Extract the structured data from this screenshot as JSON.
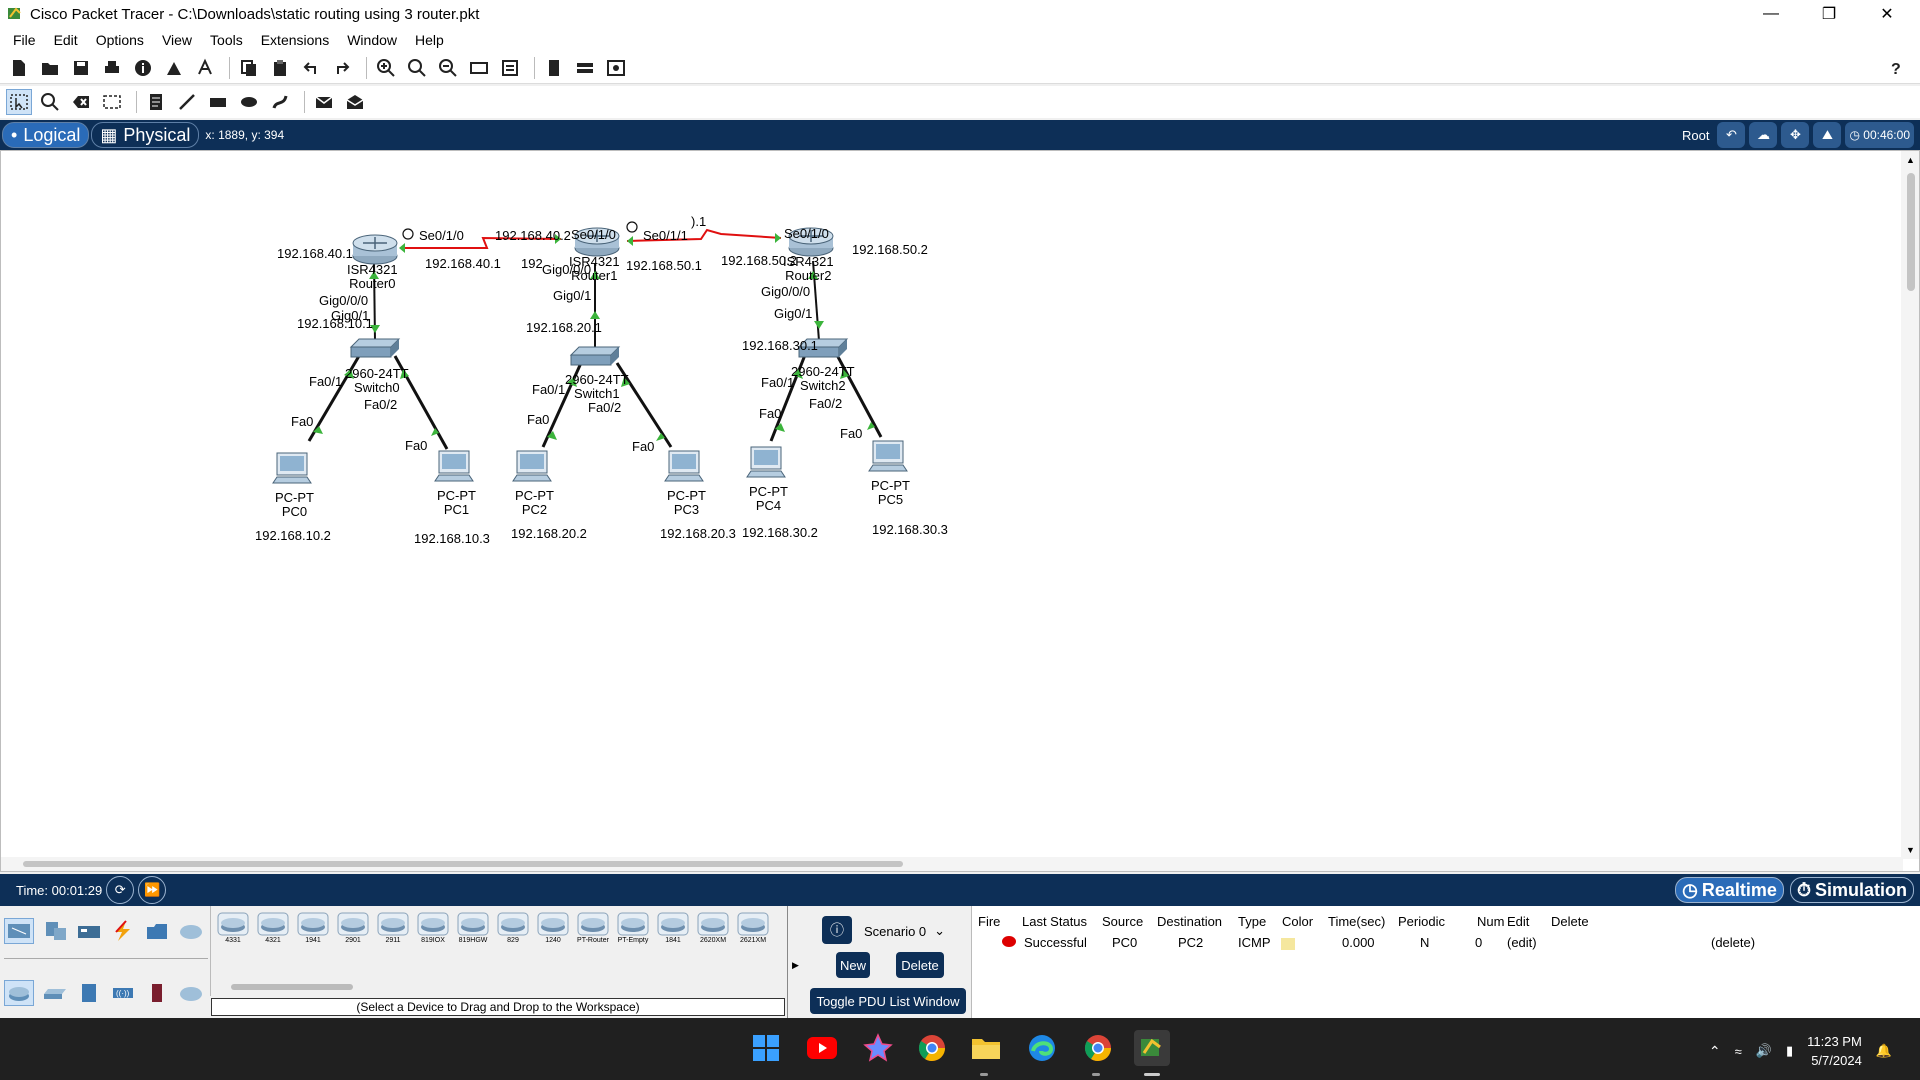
{
  "window": {
    "title": "Cisco Packet Tracer - C:\\Downloads\\static routing using 3 router.pkt"
  },
  "menu": [
    "File",
    "Edit",
    "Options",
    "View",
    "Tools",
    "Extensions",
    "Window",
    "Help"
  ],
  "modebar": {
    "logical": "Logical",
    "physical": "Physical",
    "coords": "x: 1889, y: 394",
    "root": "Root",
    "clock": "00:46:00"
  },
  "network": {
    "routers": [
      {
        "line1": "ISR4321",
        "line2": "Router0"
      },
      {
        "line1": "ISR4321",
        "line2": "Router1"
      },
      {
        "line1": "ISR4321",
        "line2": "Router2"
      }
    ],
    "switches": [
      {
        "line1": "2960-24TT",
        "line2": "Switch0"
      },
      {
        "line1": "2960-24TT",
        "line2": "Switch1"
      },
      {
        "line1": "2960-24TT",
        "line2": "Switch2"
      }
    ],
    "pcs": [
      {
        "line1": "PC-PT",
        "line2": "PC0",
        "ip": "192.168.10.2"
      },
      {
        "line1": "PC-PT",
        "line2": "PC1",
        "ip": "192.168.10.3"
      },
      {
        "line1": "PC-PT",
        "line2": "PC2",
        "ip": "192.168.20.2"
      },
      {
        "line1": "PC-PT",
        "line2": "PC3",
        "ip": "192.168.20.3"
      },
      {
        "line1": "PC-PT",
        "line2": "PC4",
        "ip": "192.168.30.2"
      },
      {
        "line1": "PC-PT",
        "line2": "PC5",
        "ip": "192.168.30.3"
      }
    ],
    "ports": {
      "r0_se": "Se0/1/0",
      "r0_gig00": "Gig0/0/0",
      "r0_gig1": "Gig0/1",
      "r1_se0": "Se0/1/0",
      "r1_se1": "Se0/1/1",
      "r1_gig00": "Gig0/0/0",
      "r1_gig1": "Gig0/1",
      "r2_se": "Se0/1/0",
      "r2_gig00": "Gig0/0/0",
      "r2_gig1": "Gig0/1",
      "sw0_fa1": "Fa0/1",
      "sw0_fa2": "Fa0/2",
      "sw1_fa1": "Fa0/1",
      "sw1_fa2": "Fa0/2",
      "sw2_fa1": "Fa0/1",
      "sw2_fa2": "Fa0/2",
      "pc0_fa": "Fa0",
      "pc1_fa": "Fa0",
      "pc2_fa": "Fa0",
      "pc3_fa": "Fa0",
      "pc4_fa": "Fa0",
      "pc5_fa": "Fa0"
    },
    "ips": {
      "r0_lan_left": "192.168.40.1",
      "r0_serial": "192.168.40.1",
      "r0_gw": "192.168.10.1",
      "r1_serial_left": "192.168.40.2",
      "r1_partial": "192",
      "r1_serial_right": "192.168.50.1",
      "r1_gw": "192.168.20.1",
      "r1_dot1": ").1",
      "r2_serial": "192.168.50.2",
      "r2_right": "192.168.50.2",
      "r2_gw": "192.168.30.1"
    }
  },
  "timebar": {
    "time": "Time: 00:01:29",
    "realtime": "Realtime",
    "simulation": "Simulation"
  },
  "device_tiles": [
    "4331",
    "4321",
    "1941",
    "2901",
    "2911",
    "819IOX",
    "819HGW",
    "829",
    "1240",
    "PT-Router",
    "PT-Empty",
    "1841",
    "2620XM",
    "2621XM"
  ],
  "device_hint": "(Select a Device to Drag and Drop to the Workspace)",
  "scenario": {
    "name": "Scenario 0",
    "new_label": "New",
    "delete_label": "Delete",
    "toggle_label": "Toggle PDU List Window"
  },
  "pdu_table": {
    "headers": [
      "Fire",
      "Last Status",
      "Source",
      "Destination",
      "Type",
      "Color",
      "Time(sec)",
      "Periodic",
      "Num",
      "Edit",
      "Delete"
    ],
    "rows": [
      {
        "status": "Successful",
        "source": "PC0",
        "destination": "PC2",
        "type": "ICMP",
        "time": "0.000",
        "periodic": "N",
        "num": "0",
        "edit": "(edit)",
        "delete": "(delete)",
        "color": "#f5e79e"
      }
    ]
  },
  "taskbar": {
    "time": "11:23 PM",
    "date": "5/7/2024"
  },
  "colors": {
    "navy": "#0d2f57",
    "serial_link": "#e01010",
    "link_up": "#3cb43c"
  }
}
